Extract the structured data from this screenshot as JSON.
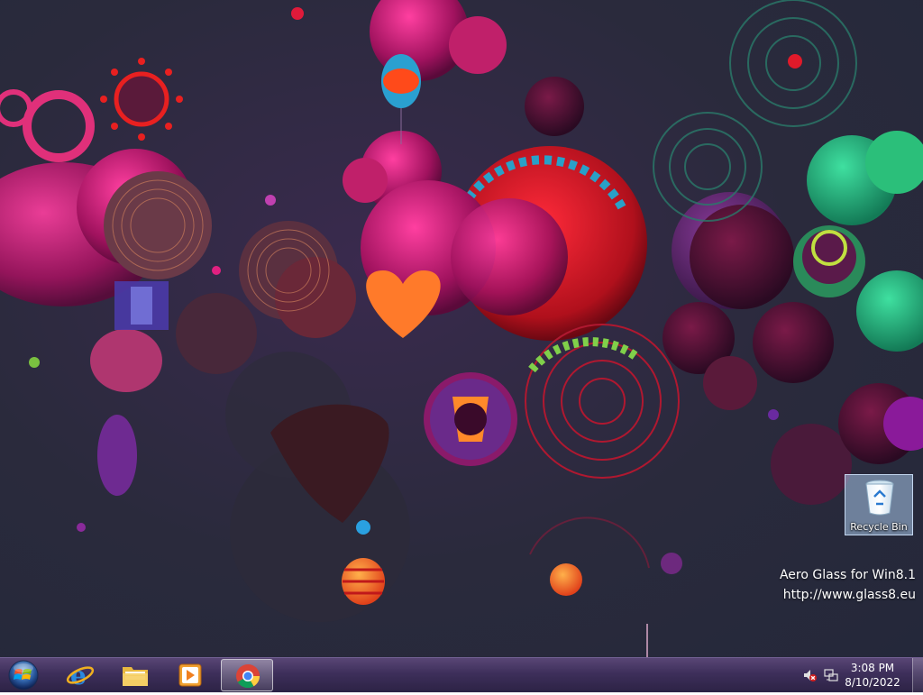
{
  "desktop": {
    "icons": [
      {
        "label": "Recycle Bin",
        "icon": "recycle-bin-icon"
      }
    ],
    "watermark": {
      "line1": "Aero Glass for Win8.1",
      "line2": "http://www.glass8.eu"
    }
  },
  "taskbar": {
    "start": {
      "icon": "windows-start-icon"
    },
    "pinned": [
      {
        "name": "Internet Explorer",
        "icon": "internet-explorer-icon"
      },
      {
        "name": "File Explorer",
        "icon": "file-explorer-icon"
      },
      {
        "name": "Windows Media Player",
        "icon": "media-player-icon"
      },
      {
        "name": "Google Chrome",
        "icon": "chrome-icon",
        "active": true
      }
    ],
    "tray": {
      "icons": [
        "volume-muted-icon",
        "network-icon"
      ],
      "time": "3:08 PM",
      "date": "8/10/2022"
    }
  },
  "colors": {
    "desktop_bg": "#2a2a3c",
    "magenta": "#c2185b",
    "red": "#d81b2c",
    "orange": "#ff7a2a",
    "green": "#2bbf7a",
    "taskbar": "#3a2a5a"
  }
}
